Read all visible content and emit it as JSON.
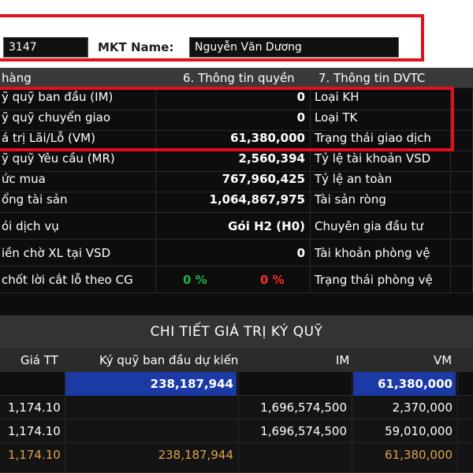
{
  "header": {
    "account_value": "3147",
    "mkt_label": "MKT Name:",
    "mkt_value": "Nguyễn Văn Dương"
  },
  "tabs": [
    {
      "label": "hàng"
    },
    {
      "label": "6. Thông tin quyền"
    },
    {
      "label": "7. Thông tin DVTC"
    }
  ],
  "info_rows": [
    {
      "label": "ỹ quỹ ban đầu (IM)",
      "value": "0",
      "right_label": "Loại KH"
    },
    {
      "label": "ỹ quỹ chuyển giao",
      "value": "0",
      "right_label": "Loại TK"
    },
    {
      "label": "á trị Lãi/Lỗ (VM)",
      "value": "61,380,000",
      "right_label": "Trạng thái giao dịch"
    },
    {
      "label": "ỹ quỹ Yêu cầu (MR)",
      "value": "2,560,394",
      "right_label": "Tỷ lệ tài khoản VSD"
    },
    {
      "label": "ức mua",
      "value": "767,960,425",
      "right_label": "Tỷ lệ an toàn"
    },
    {
      "label": "ổng tài sản",
      "value": "1,064,867,975",
      "right_label": "Tài sản ròng"
    },
    {
      "label": "ói dịch vụ",
      "value": "Gói H2 (H0)",
      "right_label": "Chuyên gia đầu tư"
    },
    {
      "label": "iền chờ XL tại VSD",
      "value": "0",
      "right_label": "Tài khoản phòng vệ"
    },
    {
      "label": "chốt lời cắt lỗ theo CG",
      "value_green": "0 %",
      "value_red": "0 %",
      "right_label": "Trạng thái phòng vệ"
    }
  ],
  "margin_detail": {
    "title": "CHI TIẾT GIÁ TRỊ KÝ QUỸ",
    "columns": [
      "Giá TT",
      "Ký quỹ ban đầu dự kiến",
      "IM",
      "VM"
    ],
    "rows": [
      {
        "price": "",
        "initial": "238,187,944",
        "im": "",
        "vm": "61,380,000"
      },
      {
        "price": "1,174.10",
        "initial": "",
        "im": "1,696,574,500",
        "vm": "2,370,000"
      },
      {
        "price": "1,174.10",
        "initial": "",
        "im": "1,696,574,500",
        "vm": "59,010,000"
      },
      {
        "price": "1,174.10",
        "initial": "238,187,944",
        "im": "",
        "vm": "61,380,000"
      }
    ]
  },
  "colors": {
    "highlight": "#e0101e",
    "selected_row": "#1c3aa6",
    "green": "#23b04a",
    "red": "#ff2b2b",
    "orange": "#e3a24a"
  }
}
